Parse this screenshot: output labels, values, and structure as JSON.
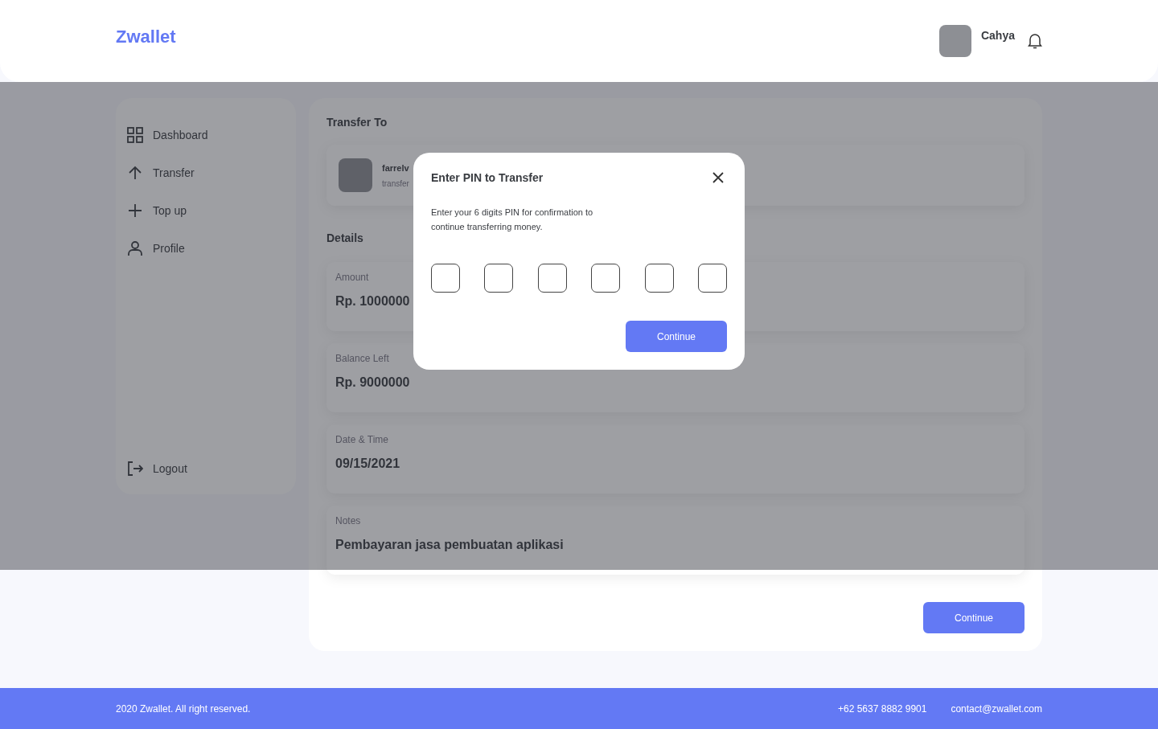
{
  "header": {
    "logo": "Zwallet",
    "user_name": "Cahya"
  },
  "sidebar": {
    "items": [
      {
        "label": "Dashboard",
        "kind": "dashboard",
        "selected": false
      },
      {
        "label": "Transfer",
        "kind": "transfer",
        "selected": false
      },
      {
        "label": "Top up",
        "kind": "topup",
        "selected": false
      },
      {
        "label": "Profile",
        "kind": "profile",
        "selected": false
      }
    ],
    "logout": {
      "label": "Logout",
      "kind": "logout"
    }
  },
  "transfer_to": {
    "title": "Transfer To",
    "name": "farrelv",
    "subtitle": "transfer"
  },
  "details": {
    "title": "Details",
    "fields": [
      {
        "label": "Amount",
        "value": "Rp. 1000000"
      },
      {
        "label": "Balance Left",
        "value": "Rp. 9000000"
      },
      {
        "label": "Date & Time",
        "value": "09/15/2021"
      },
      {
        "label": "Notes",
        "value": "Pembayaran jasa pembuatan aplikasi"
      }
    ],
    "button": "Continue"
  },
  "modal": {
    "title": "Enter PIN to Transfer",
    "text": "Enter your 6 digits PIN for confirmation to continue transferring money.",
    "pin_fields": [
      {
        "filled": false
      },
      {
        "filled": false
      },
      {
        "filled": false
      },
      {
        "filled": false
      },
      {
        "filled": false
      },
      {
        "filled": false
      }
    ],
    "button": "Continue"
  },
  "footer": {
    "copyright": "2020 Zwallet. All right reserved.",
    "phone": "+62 5637 8882 9901",
    "email": "contact@zwallet.com"
  }
}
